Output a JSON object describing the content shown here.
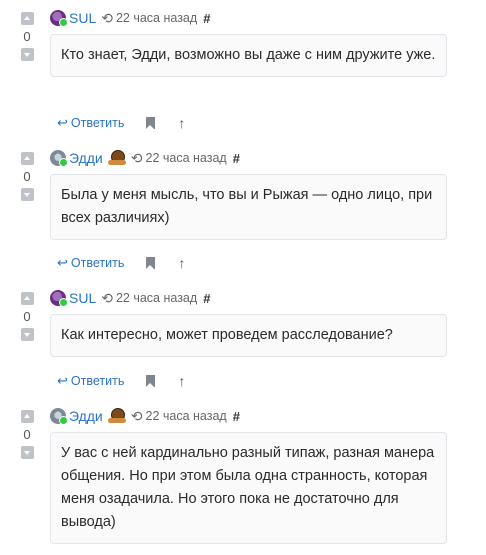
{
  "comments": [
    {
      "author": "SUL",
      "avatar": "sul-avatar",
      "online": true,
      "time": "22 часа назад",
      "anchor": "#",
      "votes": "0",
      "text": "Кто знает, Эдди, возможно вы даже с ним дружите уже.",
      "reply_label": "Ответить"
    },
    {
      "author": "Эдди",
      "avatar": "eddi-avatar",
      "online": true,
      "badge": "snail-badge",
      "time": "22 часа назад",
      "anchor": "#",
      "votes": "0",
      "text": "Была у меня мысль, что вы и Рыжая — одно лицо, при всех различиях)",
      "reply_label": "Ответить"
    },
    {
      "author": "SUL",
      "avatar": "sul-avatar",
      "online": true,
      "time": "22 часа назад",
      "anchor": "#",
      "votes": "0",
      "text": "Как интересно, может проведем расследование?",
      "reply_label": "Ответить"
    },
    {
      "author": "Эдди",
      "avatar": "eddi-avatar",
      "online": true,
      "badge": "snail-badge",
      "time": "22 часа назад",
      "anchor": "#",
      "votes": "0",
      "text": "У вас с ней кардинально разный типаж, разная манера общения. Но при этом была одна странность, которая меня озадачила. Но этого пока не достаточно для вывода)",
      "reply_label": "Ответить"
    }
  ],
  "colors": {
    "link": "#2a73c9",
    "online": "#2ecc40",
    "vote_button": "#bfc3c8"
  },
  "icons": {
    "history": "history-icon",
    "reply": "reply-arrow-icon",
    "bookmark": "bookmark-icon",
    "scroll_up": "arrow-up-icon"
  }
}
